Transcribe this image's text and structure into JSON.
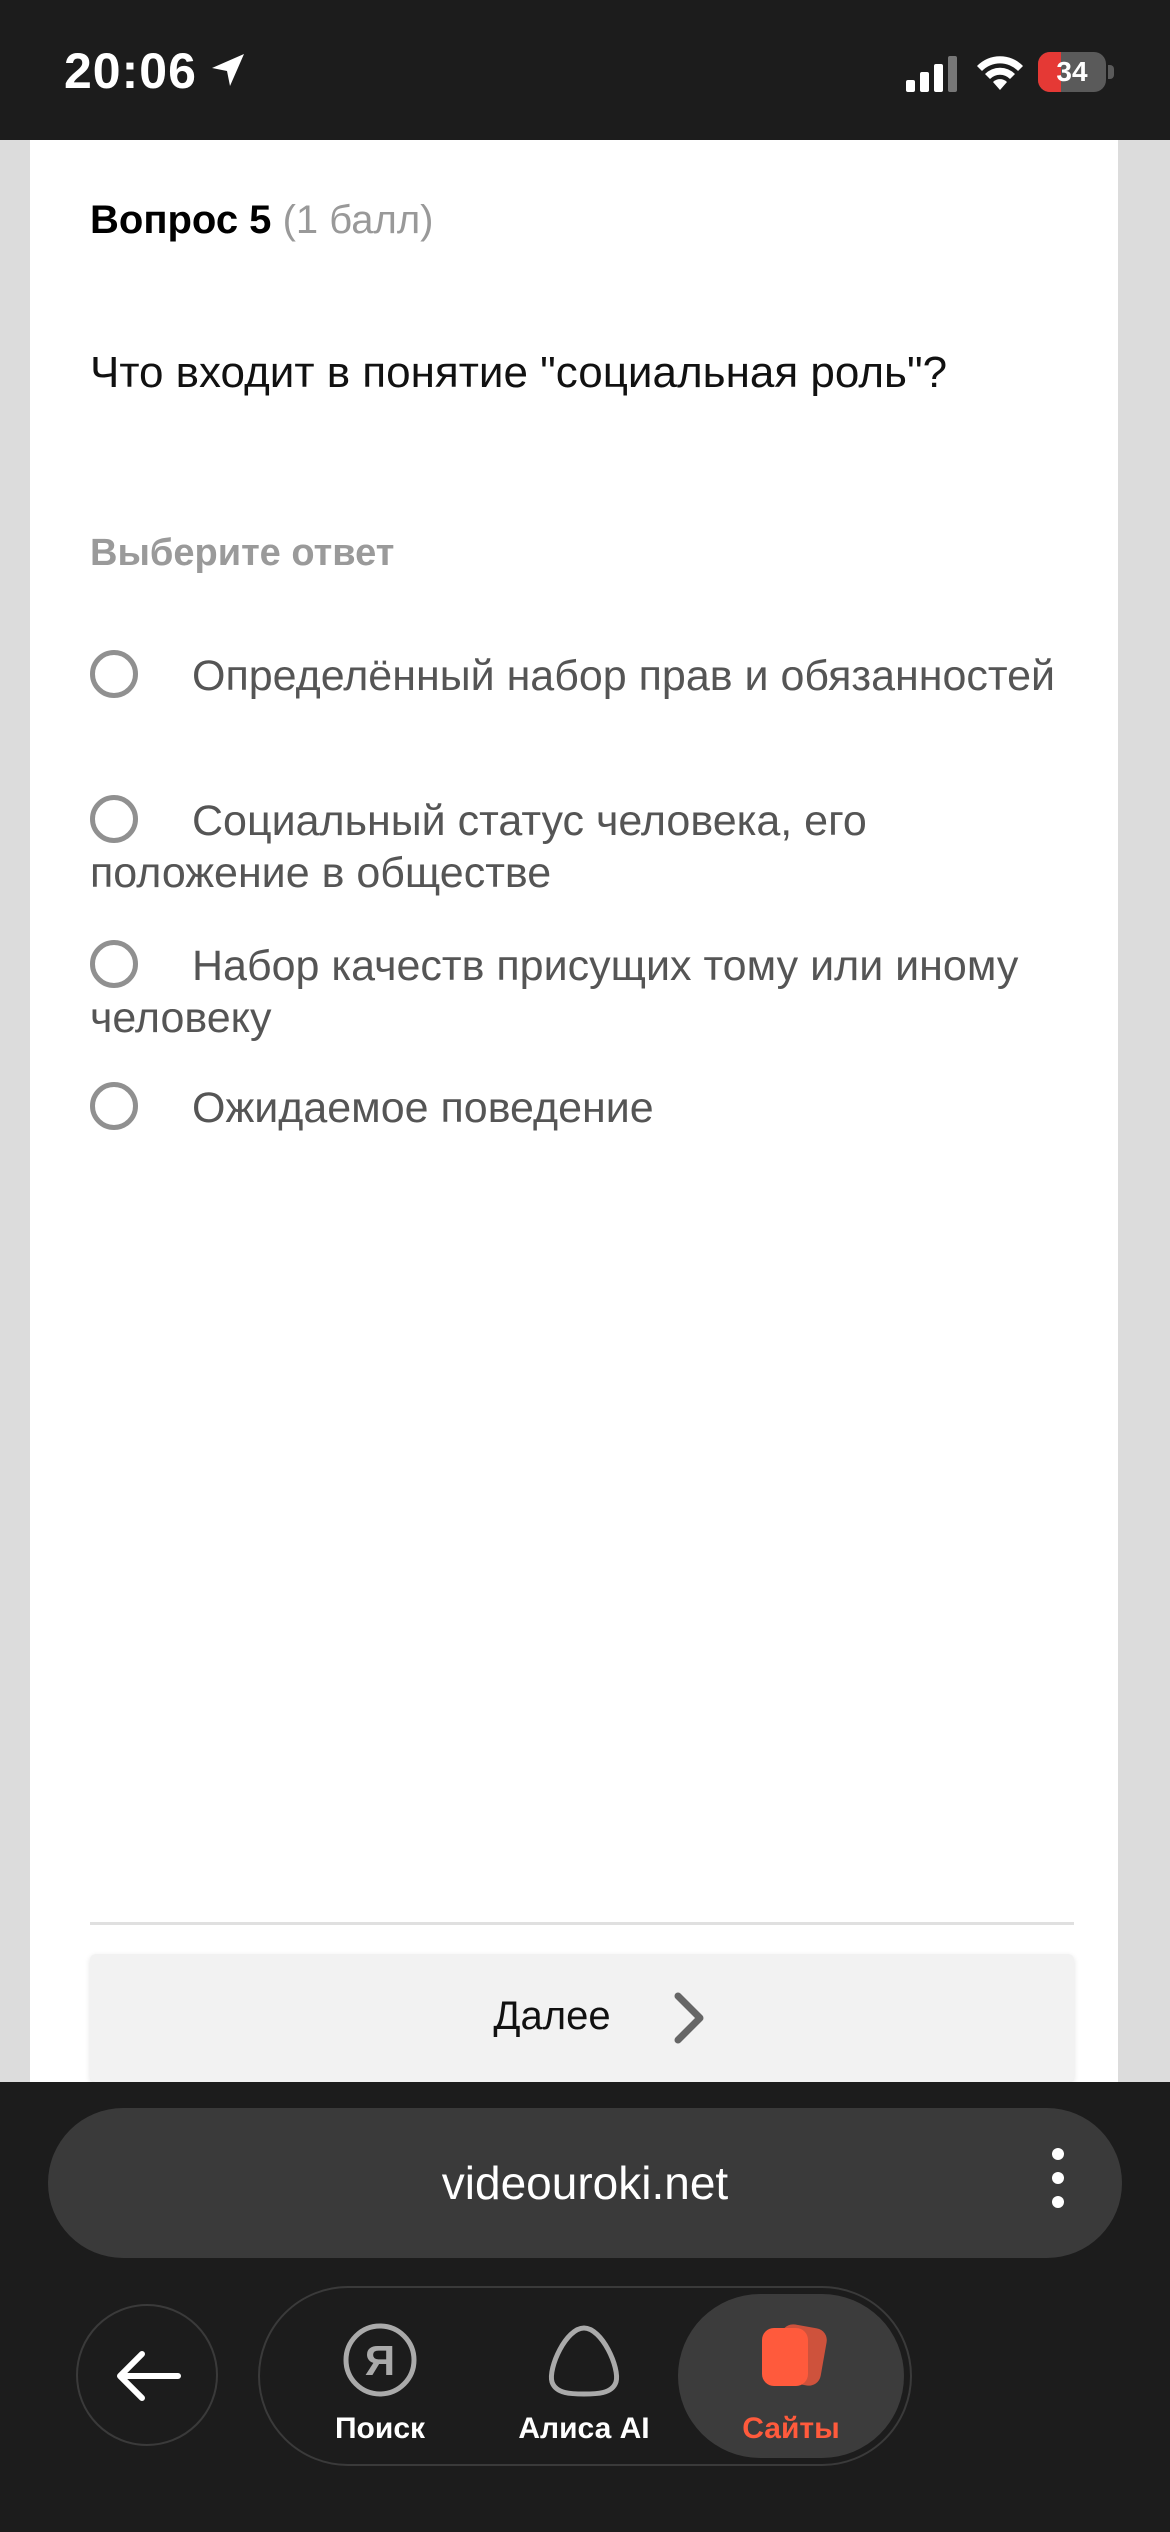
{
  "status_bar": {
    "time": "20:06",
    "battery": "34"
  },
  "question": {
    "number": "Вопрос 5",
    "points": "(1 балл)",
    "text": "Что входит в понятие \"социальная роль\"?",
    "prompt": "Выберите ответ",
    "options": [
      {
        "label": "Определённый набор прав и обязанностей",
        "selected": false
      },
      {
        "label": "Социальный статус человека, его положение в обществе",
        "selected": false
      },
      {
        "label": "Набор качеств присущих тому или иному человеку",
        "selected": false
      },
      {
        "label": "Ожидаемое поведение",
        "selected": false
      }
    ]
  },
  "next_button": {
    "label": "Далее",
    "icon": "chevron-right-icon"
  },
  "browser": {
    "url": "videouroki.net",
    "nav": [
      {
        "label": "Поиск",
        "icon": "yandex-icon"
      },
      {
        "label": "Алиса AI",
        "icon": "alice-icon"
      },
      {
        "label": "Сайты",
        "icon": "sites-icon",
        "active": true
      }
    ],
    "accent_color": "#ff5a3c"
  }
}
